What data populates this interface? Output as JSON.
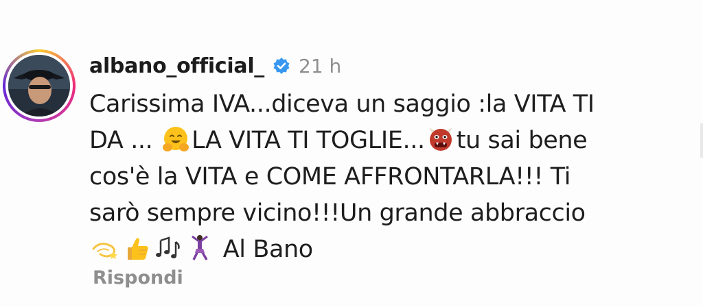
{
  "comment": {
    "username": "albano_official_",
    "verified_icon": "verified-badge-icon",
    "time": "21 h",
    "lines": {
      "l1": "Carissima IVA...diceva un saggio :la VITA TI",
      "l2a": "DA ...",
      "l2b": "LA VITA TI TOGLIE...",
      "l2c": "tu sai bene",
      "l3": "cos'è la VITA e COME AFFRONTARLA!!! Ti",
      "l4": "sarò sempre vicino!!!Un grande abbraccio",
      "l5": "Al Bano"
    },
    "emojis": [
      "hugging-face-emoji",
      "ogre-emoji",
      "dizzy-emoji",
      "thumbs-up-emoji",
      "musical-notes-emoji",
      "dancer-emoji"
    ],
    "reply_label": "Rispondi"
  },
  "colors": {
    "text": "#1e1e1e",
    "muted": "#8e8e8e",
    "verified": "#3897f0"
  }
}
